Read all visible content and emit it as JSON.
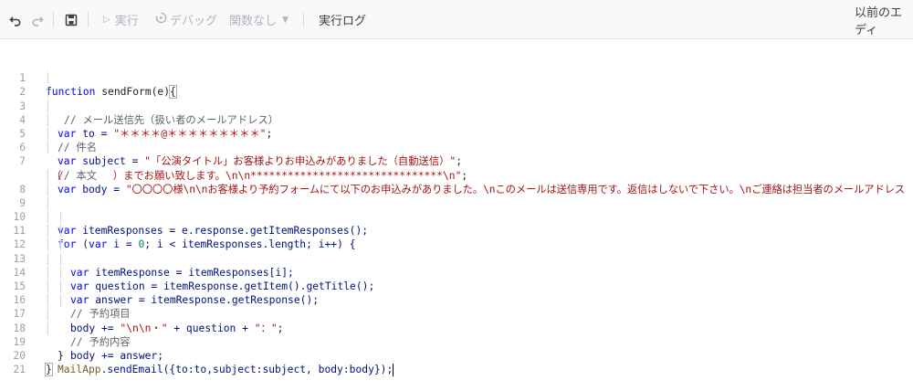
{
  "toolbar": {
    "undo_icon": "undo-icon",
    "redo_icon": "redo-icon",
    "save_icon": "save-icon",
    "run_label": "実行",
    "debug_label": "デバッグ",
    "function_label": "関数なし",
    "log_label": "実行ログ",
    "prev_editor_label": "以前のエディ"
  },
  "editor": {
    "line_numbers": [
      "1",
      "2",
      "3",
      "4",
      "5",
      "6",
      "7",
      "8",
      "9",
      "10",
      "11",
      "12",
      "13",
      "14",
      "15",
      "16",
      "17",
      "18",
      "19",
      "20",
      "21"
    ],
    "code": {
      "l1": {
        "kw": "function",
        "name": " sendForm(e)",
        "brace": "{"
      },
      "l2": {
        "comment": "// メール送信先（扱い者のメールアドレス）"
      },
      "l3": {
        "kw": "var",
        "id": " to = ",
        "str": "\"＊＊＊＊@＊＊＊＊＊＊＊＊＊\"",
        "end": ";"
      },
      "l4": {
        "comment": "// 件名"
      },
      "l5": {
        "kw": "var",
        "id": " subject = ",
        "str": "\"「公演タイトル」お客様よりお申込みがありました（自動送信）\"",
        "end": ";"
      },
      "l6": {
        "comment": "// 本文"
      },
      "l7": {
        "kw": "var",
        "id": " body = ",
        "str": "\"〇〇〇〇様\\n\\nお客様より予約フォームにて以下のお申込みがありました。\\nこのメールは送信専用です。返信はしないで下さい。\\nご連絡は担当者のメールアドレス"
      },
      "l7b": {
        "str": "（　　　　　）までお願い致します。\\n\\n*******************************\\n\"",
        "end": ";"
      },
      "l9": {
        "kw": "var",
        "id": " itemResponses = e.response.getItemResponses();"
      },
      "l10": {
        "kw": "for",
        "pre": " (",
        "kw2": "var",
        "id": " i = ",
        "num": "0",
        "rest": "; i < itemResponses.length; i++) {"
      },
      "l11": {
        "kw": "var",
        "id": " itemResponse = itemResponses[i];"
      },
      "l12": {
        "kw": "var",
        "id": " question = itemResponse.getItem().getTitle();"
      },
      "l13": {
        "kw": "var",
        "id": " answer = itemResponse.getResponse();"
      },
      "l14": {
        "comment": "// 予約項目"
      },
      "l15": {
        "id": "body += ",
        "str": "\"\\n\\n・\"",
        "mid": " + question + ",
        "str2": "\"：\"",
        "end": ";"
      },
      "l16": {
        "comment": "// 予約内容"
      },
      "l17": {
        "id": "body += answer;"
      },
      "l18": {
        "brace": "}"
      },
      "l19": {
        "cls": "MailApp",
        "rest": ".sendEmail({to:to,subject:subject, body:body});"
      },
      "l20": {
        "brace": "}"
      }
    }
  }
}
